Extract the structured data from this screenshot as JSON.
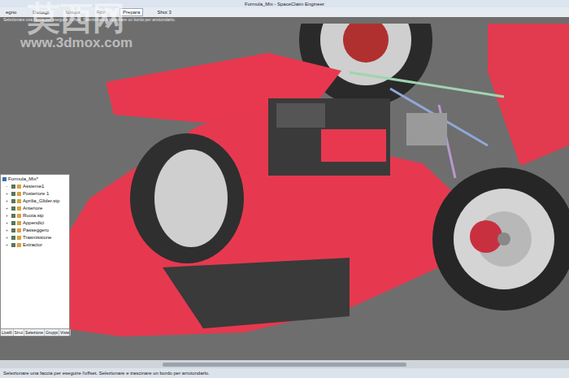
{
  "window": {
    "title": "Formula_Mix - SpaceClaim Engineer"
  },
  "watermark": {
    "logo": "莫西网",
    "url": "www.3dmox.com"
  },
  "ribbon": {
    "tabs": [
      {
        "label": "egno",
        "selected": false
      },
      {
        "label": "Dettagli",
        "selected": false
      },
      {
        "label": "Misura",
        "selected": false
      },
      {
        "label": "Filtri",
        "selected": false
      },
      {
        "label": "Prepara",
        "selected": true
      },
      {
        "label": "Shot 3",
        "selected": false
      }
    ]
  },
  "hint": "Selezionare una faccia per eseguire l'offset. Selezionare e trascinare un bordo per arrotondarlo.",
  "tree": {
    "root": "Formula_Mix*",
    "items": [
      {
        "label": "Assieme1",
        "checked": true,
        "expanded": true
      },
      {
        "label": "Posteriore 1",
        "checked": true,
        "expanded": false
      },
      {
        "label": "Aprilia_Glider.stp",
        "checked": true,
        "expanded": false
      },
      {
        "label": "Anteriore",
        "checked": true,
        "expanded": false
      },
      {
        "label": "Ruota.stp",
        "checked": true,
        "expanded": false
      },
      {
        "label": "Appendici",
        "checked": true,
        "expanded": false
      },
      {
        "label": "Passeggero",
        "checked": true,
        "expanded": false
      },
      {
        "label": "Trasmissione",
        "checked": true,
        "expanded": false
      },
      {
        "label": "Extractor",
        "checked": true,
        "expanded": false
      }
    ],
    "tabs": [
      {
        "label": "Livelli",
        "selected": false
      },
      {
        "label": "Strut",
        "selected": true
      },
      {
        "label": "Selezione",
        "selected": false
      },
      {
        "label": "Gruppi",
        "selected": false
      },
      {
        "label": "Viste",
        "selected": false
      }
    ]
  },
  "status_bar": "Selezionare una faccia per eseguire l'offset. Selezionare e trascinare un bordo per arrotondarlo."
}
